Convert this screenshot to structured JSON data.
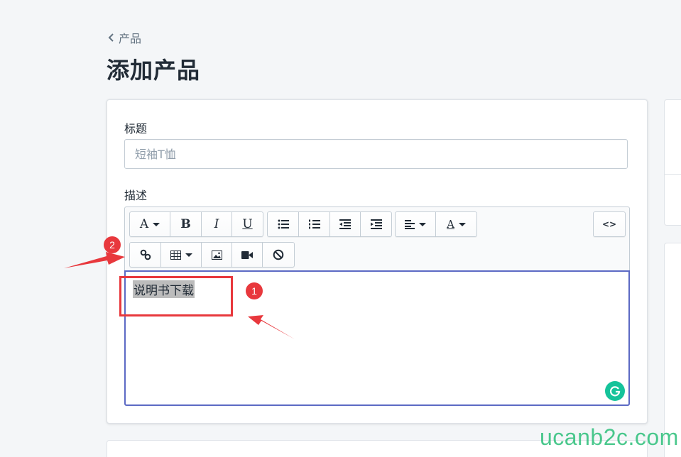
{
  "breadcrumb": {
    "label": "产品"
  },
  "page": {
    "title": "添加产品"
  },
  "form": {
    "title_label": "标题",
    "title_placeholder": "短袖T恤",
    "title_value": "",
    "description_label": "描述"
  },
  "toolbar": {
    "font_button": "A",
    "bold_button": "B",
    "italic_button": "I",
    "underline_button": "U",
    "text_color_button": "A",
    "html_button": "<>"
  },
  "editor": {
    "content": "说明书下载"
  },
  "annotations": {
    "badge_1": "1",
    "badge_2": "2"
  },
  "watermark": {
    "text": "ucanb2c.com"
  },
  "colors": {
    "accent": "#5c6ac4",
    "annotation_red": "#e8383d",
    "grammarly_green": "#15c39a",
    "watermark_green": "#2cbf7a"
  }
}
